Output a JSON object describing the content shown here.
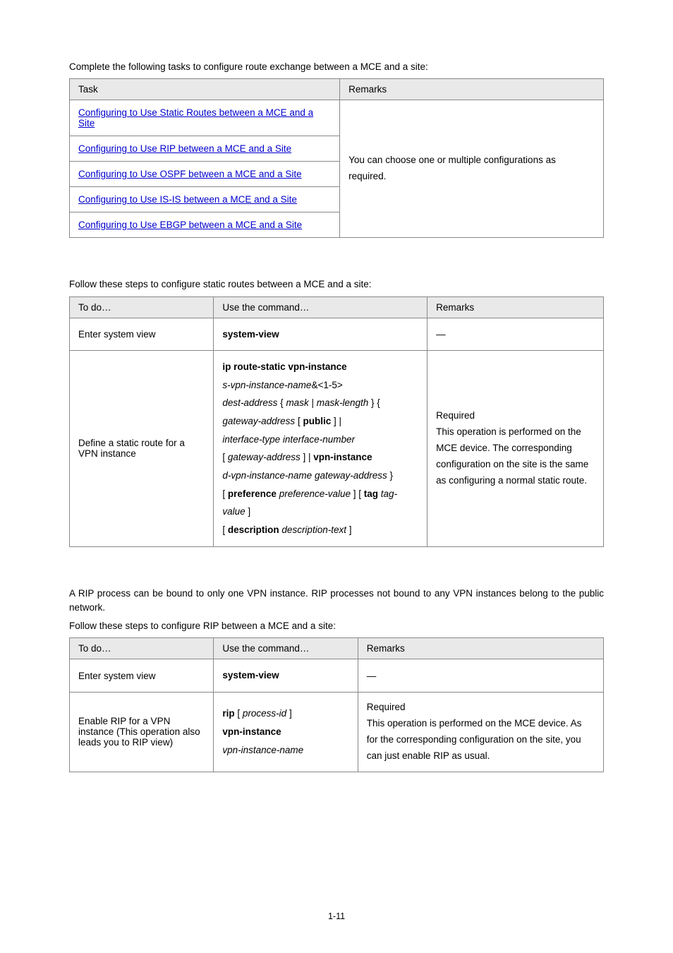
{
  "intro1": "Complete the following tasks to configure route exchange between a MCE and a site:",
  "table1": {
    "header_task": "Task",
    "header_remarks": "Remarks",
    "rows": [
      "Configuring to Use Static Routes between a MCE and a Site",
      "Configuring to Use RIP between a MCE and a Site",
      "Configuring to Use OSPF between a MCE and a Site",
      "Configuring to Use IS-IS between a MCE and a Site",
      "Configuring to Use EBGP between a MCE and a Site"
    ],
    "remarks": "You can choose one or multiple configurations as required."
  },
  "section_static": {
    "heading": "Configuring to Use Static Routes between a MCE and a Site",
    "intro": "Follow these steps to configure static routes between a MCE and a site:",
    "header_todo": "To do…",
    "header_cmd": "Use the command…",
    "header_remarks": "Remarks",
    "row1_todo": "Enter system view",
    "row1_cmd": "system-view",
    "row1_remarks": "—",
    "row2_todo": "Define a static route for a VPN instance",
    "row2_remarks": "Required\nThis operation is performed on the MCE device. The corresponding configuration on the site is the same as configuring a normal static route."
  },
  "section_rip": {
    "heading": "Configuring to Use RIP between a MCE and a Site",
    "intro1": "A RIP process can be bound to only one VPN instance. RIP processes not bound to any VPN instances belong to the public network.",
    "intro2": "Follow these steps to configure RIP between a MCE and a site:",
    "header_todo": "To do…",
    "header_cmd": "Use the command…",
    "header_remarks": "Remarks",
    "row1_todo": "Enter system view",
    "row1_cmd": "system-view",
    "row1_remarks": "—",
    "row2_todo": "Enable RIP for a VPN instance (This operation also leads you to RIP view)",
    "row2_remarks": "Required\nThis operation is performed on the MCE device. As for the corresponding configuration on the site, you can just enable RIP as usual."
  },
  "footer": "1-11"
}
